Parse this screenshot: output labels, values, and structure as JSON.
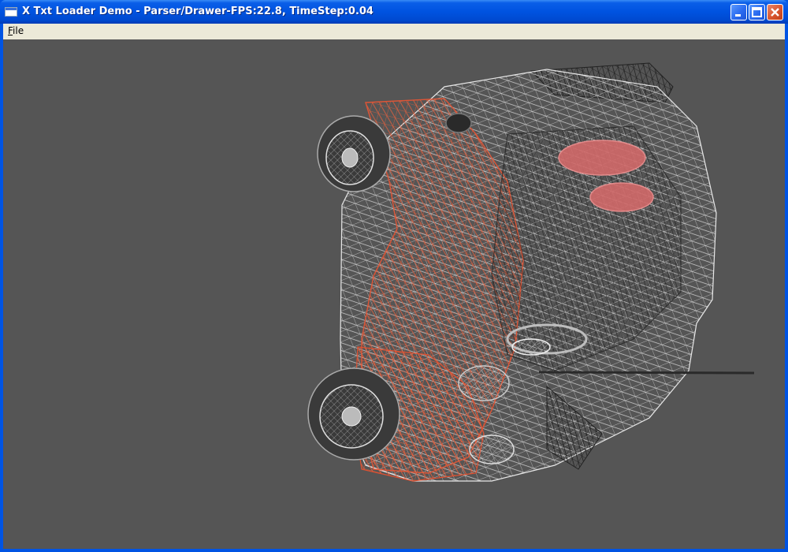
{
  "window": {
    "title": "X Txt Loader Demo - Parser/Drawer-FPS:22.8,  TimeStep:0.04"
  },
  "menubar": {
    "items": [
      {
        "label": "File",
        "mnemonic": "F",
        "rest": "ile"
      }
    ]
  },
  "title_buttons": {
    "minimize": "minimize-icon",
    "maximize": "maximize-icon",
    "close": "close-icon"
  },
  "colors": {
    "titlebar": "#0054e3",
    "menubar": "#ece9d8",
    "viewport_bg": "#555555",
    "wire_red": "#e05a3a",
    "wire_white": "#d8d8d8",
    "wire_dark": "#222222"
  }
}
